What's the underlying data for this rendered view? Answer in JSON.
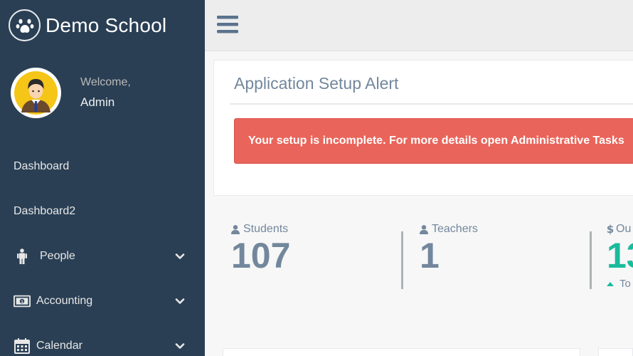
{
  "brand": {
    "title": "Demo School",
    "icon": "paw-icon"
  },
  "profile": {
    "welcome": "Welcome,",
    "name": "Admin",
    "icon": "user-avatar-icon"
  },
  "menu": [
    {
      "label": "Dashboard"
    },
    {
      "label": "Dashboard2"
    },
    {
      "label": "People",
      "icon": "person-icon",
      "expandable": true
    },
    {
      "label": "Accounting",
      "icon": "money-icon",
      "expandable": true
    },
    {
      "label": "Calendar",
      "icon": "calendar-icon",
      "expandable": true
    }
  ],
  "topbar": {
    "icon": "hamburger-icon"
  },
  "setup_alert": {
    "title": "Application Setup Alert",
    "message": "Your setup is incomplete. For more details open Administrative Tasks"
  },
  "stats": [
    {
      "label": "Students",
      "value": "107",
      "icon": "user-icon"
    },
    {
      "label": "Teachers",
      "value": "1",
      "icon": "user-icon"
    },
    {
      "label": "Ou",
      "value": "13",
      "icon": "dollar-icon",
      "sub": "To"
    }
  ],
  "colors": {
    "sidebar": "#2a3f54",
    "alert": "#e9645a",
    "text_muted": "#73879c",
    "accent_green": "#1abb9c"
  }
}
